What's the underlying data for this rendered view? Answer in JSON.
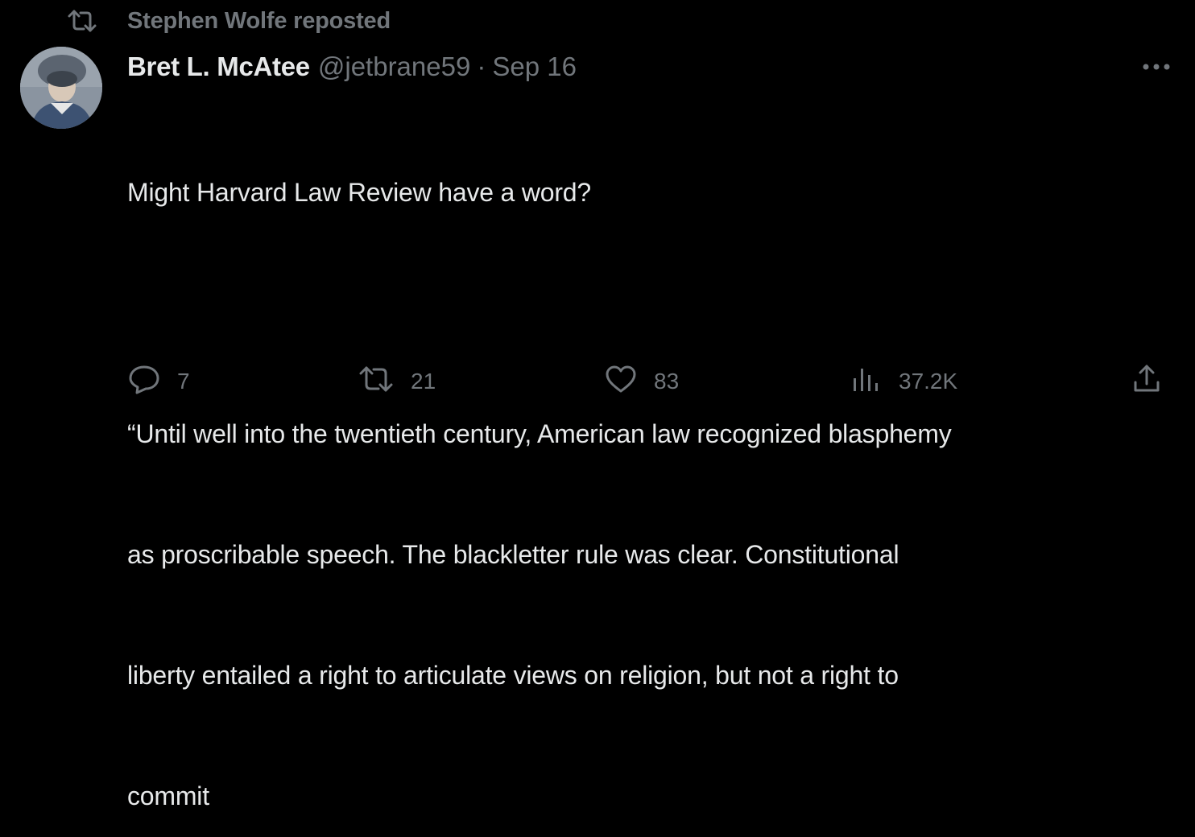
{
  "repost_banner": {
    "icon": "repost-icon",
    "text": "Stephen Wolfe reposted"
  },
  "tweet": {
    "author": {
      "display_name": "Bret L. McAtee",
      "handle": "@jetbrane59",
      "separator": "·",
      "date": "Sep 16"
    },
    "text": {
      "line1": "Might Harvard Law Review have a word?",
      "quote_line1": "“Until well into the twentieth century, American law recognized blasphemy",
      "quote_line2": "as proscribable speech. The blackletter rule was clear. Constitutional",
      "quote_line3": "liberty entailed a right to articulate views on religion, but not a right to",
      "quote_line4": "commit"
    },
    "actions": {
      "reply_count": "7",
      "repost_count": "21",
      "like_count": "83",
      "views_count": "37.2K"
    }
  },
  "colors": {
    "background": "#000000",
    "primary_text": "#e7e9ea",
    "secondary_text": "#71767b"
  }
}
